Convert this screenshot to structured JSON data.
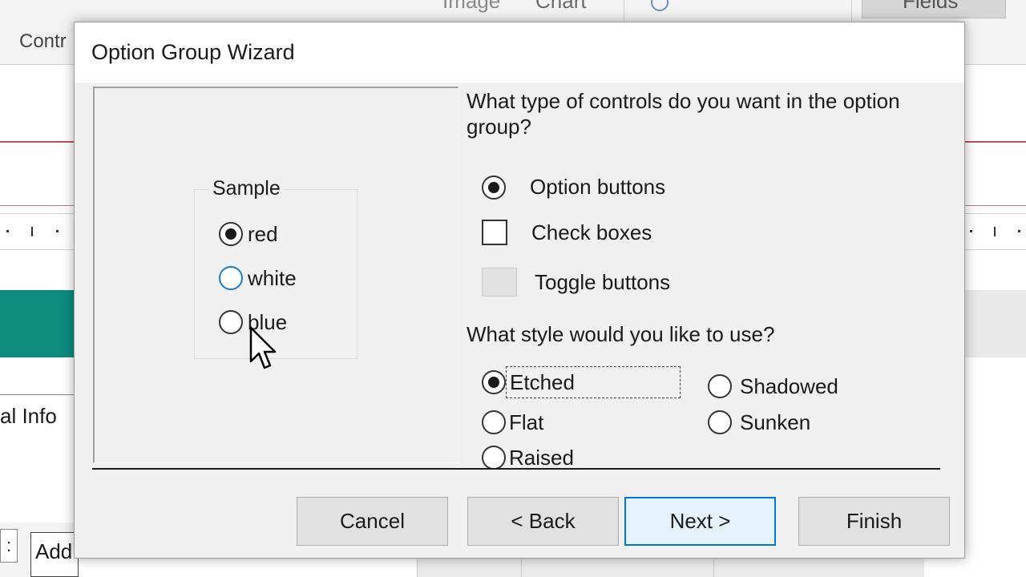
{
  "background": {
    "ribbon_items": [
      "Image",
      "Chart"
    ],
    "fields_button": "Fields",
    "controls_group": "Contr",
    "tab_label": "al Info",
    "field_box_text": "Add",
    "field_colon": ":",
    "teal_color": "#0e8c7e",
    "accent_line_color": "#b8505e"
  },
  "dialog": {
    "title": "Option Group Wizard",
    "sample": {
      "legend": "Sample",
      "options": [
        {
          "label": "red",
          "checked": true
        },
        {
          "label": "white",
          "checked": false
        },
        {
          "label": "blue",
          "checked": false
        }
      ]
    },
    "controls_question": "What type of controls do you want in the option group?",
    "control_types": [
      {
        "label": "Option buttons",
        "kind": "radio-icon",
        "selected": true
      },
      {
        "label": "Check boxes",
        "kind": "checkbox-icon",
        "selected": false
      },
      {
        "label": "Toggle buttons",
        "kind": "toggle-icon",
        "selected": false
      }
    ],
    "style_question": "What style would you like to use?",
    "styles": [
      {
        "label": "Etched",
        "checked": true
      },
      {
        "label": "Shadowed",
        "checked": false
      },
      {
        "label": "Flat",
        "checked": false
      },
      {
        "label": "Sunken",
        "checked": false
      },
      {
        "label": "Raised",
        "checked": false
      }
    ],
    "buttons": {
      "cancel": "Cancel",
      "back": "< Back",
      "next": "Next >",
      "finish": "Finish"
    },
    "accent_color": "#0078d7"
  }
}
